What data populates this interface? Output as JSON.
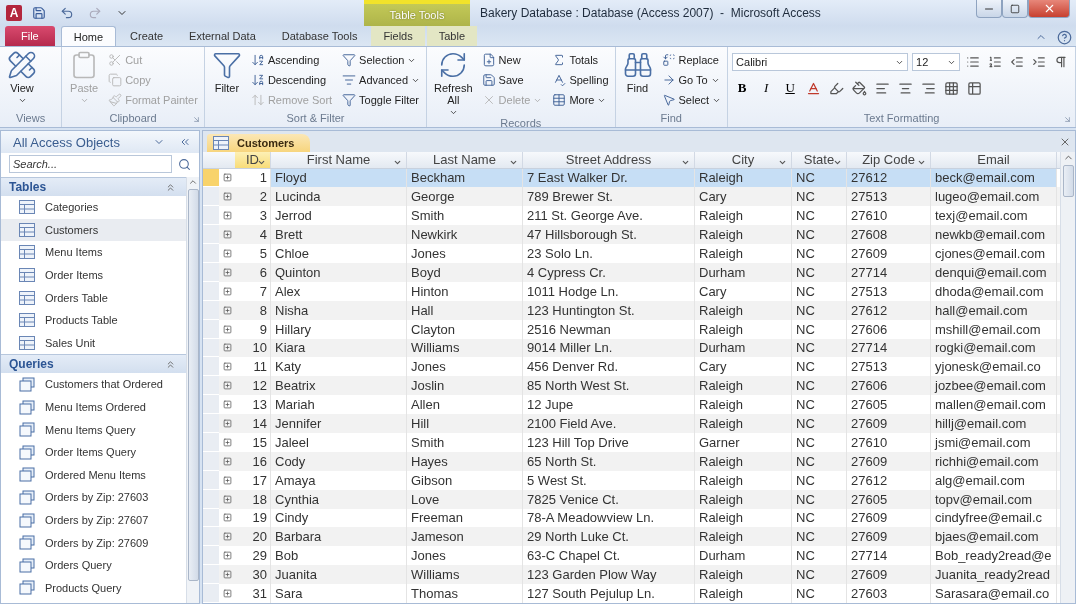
{
  "window": {
    "app_logo": "A",
    "title": "Bakery Database : Database (Access 2007)  -  Microsoft Access",
    "context_label": "Table Tools"
  },
  "tabs": [
    {
      "label": "File",
      "kind": "file",
      "selected": false
    },
    {
      "label": "Home",
      "kind": "normal",
      "selected": true
    },
    {
      "label": "Create",
      "kind": "normal",
      "selected": false
    },
    {
      "label": "External Data",
      "kind": "normal",
      "selected": false
    },
    {
      "label": "Database Tools",
      "kind": "normal",
      "selected": false
    },
    {
      "label": "Fields",
      "kind": "context",
      "selected": false
    },
    {
      "label": "Table",
      "kind": "context",
      "selected": false
    }
  ],
  "ribbon": {
    "groups": [
      {
        "label": "Views",
        "launcher": false,
        "items": [
          {
            "label": "View",
            "kind": "large",
            "menu": true,
            "disabled": false
          }
        ]
      },
      {
        "label": "Clipboard",
        "launcher": true,
        "items": [
          {
            "label": "Paste",
            "kind": "large",
            "menu": true,
            "disabled": true
          },
          {
            "label": "Cut",
            "kind": "small",
            "menu": false,
            "disabled": true
          },
          {
            "label": "Copy",
            "kind": "small",
            "menu": false,
            "disabled": true
          },
          {
            "label": "Format Painter",
            "kind": "small",
            "menu": false,
            "disabled": true
          }
        ]
      },
      {
        "label": "Sort & Filter",
        "launcher": false,
        "items": [
          {
            "label": "Filter",
            "kind": "large",
            "menu": false,
            "disabled": false
          },
          {
            "label": "Ascending",
            "kind": "small",
            "menu": false,
            "disabled": false
          },
          {
            "label": "Descending",
            "kind": "small",
            "menu": false,
            "disabled": false
          },
          {
            "label": "Remove Sort",
            "kind": "small",
            "menu": false,
            "disabled": true
          },
          {
            "label": "Selection",
            "kind": "small",
            "menu": true,
            "disabled": false
          },
          {
            "label": "Advanced",
            "kind": "small",
            "menu": true,
            "disabled": false
          },
          {
            "label": "Toggle Filter",
            "kind": "small",
            "menu": false,
            "disabled": false
          }
        ]
      },
      {
        "label": "Records",
        "launcher": false,
        "items": [
          {
            "label": "Refresh All",
            "kind": "large",
            "menu": true,
            "disabled": false
          },
          {
            "label": "New",
            "kind": "small",
            "menu": false,
            "disabled": false
          },
          {
            "label": "Save",
            "kind": "small",
            "menu": false,
            "disabled": false
          },
          {
            "label": "Delete",
            "kind": "small",
            "menu": true,
            "disabled": true
          },
          {
            "label": "Totals",
            "kind": "small",
            "menu": false,
            "disabled": false
          },
          {
            "label": "Spelling",
            "kind": "small",
            "menu": false,
            "disabled": false
          },
          {
            "label": "More",
            "kind": "small",
            "menu": true,
            "disabled": false
          }
        ]
      },
      {
        "label": "Find",
        "launcher": false,
        "items": [
          {
            "label": "Find",
            "kind": "large",
            "menu": false,
            "disabled": false
          },
          {
            "label": "Replace",
            "kind": "small",
            "menu": false,
            "disabled": false
          },
          {
            "label": "Go To",
            "kind": "small",
            "menu": true,
            "disabled": false
          },
          {
            "label": "Select",
            "kind": "small",
            "menu": true,
            "disabled": false
          }
        ]
      }
    ],
    "text_formatting": {
      "label": "Text Formatting",
      "font": "Calibri",
      "size": "12",
      "style_buttons": [
        "B",
        "I",
        "U"
      ],
      "launcher": true
    }
  },
  "navigation": {
    "title": "All Access Objects",
    "search_placeholder": "Search...",
    "groups": [
      {
        "label": "Tables",
        "kind": "table",
        "items": [
          {
            "label": "Categories",
            "selected": false
          },
          {
            "label": "Customers",
            "selected": true
          },
          {
            "label": "Menu Items",
            "selected": false
          },
          {
            "label": "Order Items",
            "selected": false
          },
          {
            "label": "Orders Table",
            "selected": false
          },
          {
            "label": "Products Table",
            "selected": false
          },
          {
            "label": "Sales Unit",
            "selected": false
          }
        ]
      },
      {
        "label": "Queries",
        "kind": "query",
        "items": [
          {
            "label": "Customers that Ordered",
            "selected": false
          },
          {
            "label": "Menu Items Ordered",
            "selected": false
          },
          {
            "label": "Menu Items Query",
            "selected": false
          },
          {
            "label": "Order Items Query",
            "selected": false
          },
          {
            "label": "Ordered Menu Items",
            "selected": false
          },
          {
            "label": "Orders by Zip: 27603",
            "selected": false
          },
          {
            "label": "Orders by Zip: 27607",
            "selected": false
          },
          {
            "label": "Orders by Zip: 27609",
            "selected": false
          },
          {
            "label": "Orders Query",
            "selected": false
          },
          {
            "label": "Products Query",
            "selected": false
          }
        ]
      }
    ]
  },
  "datasheet": {
    "tab": "Customers",
    "columns": [
      {
        "label": "ID",
        "menu": true,
        "selected": true
      },
      {
        "label": "First Name",
        "menu": true,
        "selected": false
      },
      {
        "label": "Last Name",
        "menu": true,
        "selected": false
      },
      {
        "label": "Street Address",
        "menu": true,
        "selected": false
      },
      {
        "label": "City",
        "menu": true,
        "selected": false
      },
      {
        "label": "State",
        "menu": true,
        "selected": false
      },
      {
        "label": "Zip Code",
        "menu": true,
        "selected": false
      },
      {
        "label": "Email",
        "menu": false,
        "selected": false
      }
    ],
    "rows": [
      {
        "selected": true,
        "cells": [
          "1",
          "Floyd",
          "Beckham",
          "7 East Walker Dr.",
          "Raleigh",
          "NC",
          "27612",
          "beck@email.com"
        ]
      },
      {
        "selected": false,
        "cells": [
          "2",
          "Lucinda",
          "George",
          "789 Brewer St.",
          "Cary",
          "NC",
          "27513",
          "lugeo@email.com"
        ]
      },
      {
        "selected": false,
        "cells": [
          "3",
          "Jerrod",
          "Smith",
          "211 St. George Ave.",
          "Raleigh",
          "NC",
          "27610",
          "texj@email.com"
        ]
      },
      {
        "selected": false,
        "cells": [
          "4",
          "Brett",
          "Newkirk",
          "47 Hillsborough St.",
          "Raleigh",
          "NC",
          "27608",
          "newkb@email.com"
        ]
      },
      {
        "selected": false,
        "cells": [
          "5",
          "Chloe",
          "Jones",
          "23 Solo Ln.",
          "Raleigh",
          "NC",
          "27609",
          "cjones@email.com"
        ]
      },
      {
        "selected": false,
        "cells": [
          "6",
          "Quinton",
          "Boyd",
          "4 Cypress Cr.",
          "Durham",
          "NC",
          "27714",
          "denqui@email.com"
        ]
      },
      {
        "selected": false,
        "cells": [
          "7",
          "Alex",
          "Hinton",
          "1011 Hodge Ln.",
          "Cary",
          "NC",
          "27513",
          "dhoda@email.com"
        ]
      },
      {
        "selected": false,
        "cells": [
          "8",
          "Nisha",
          "Hall",
          "123 Huntington St.",
          "Raleigh",
          "NC",
          "27612",
          "hall@email.com"
        ]
      },
      {
        "selected": false,
        "cells": [
          "9",
          "Hillary",
          "Clayton",
          "2516 Newman",
          "Raleigh",
          "NC",
          "27606",
          "mshill@email.com"
        ]
      },
      {
        "selected": false,
        "cells": [
          "10",
          "Kiara",
          "Williams",
          "9014 Miller Ln.",
          "Durham",
          "NC",
          "27714",
          "rogki@email.com"
        ]
      },
      {
        "selected": false,
        "cells": [
          "11",
          "Katy",
          "Jones",
          "456 Denver Rd.",
          "Cary",
          "NC",
          "27513",
          "yjonesk@email.co"
        ]
      },
      {
        "selected": false,
        "cells": [
          "12",
          "Beatrix",
          "Joslin",
          "85 North West St.",
          "Raleigh",
          "NC",
          "27606",
          "jozbee@email.com"
        ]
      },
      {
        "selected": false,
        "cells": [
          "13",
          "Mariah",
          "Allen",
          "12 Jupe",
          "Raleigh",
          "NC",
          "27605",
          "mallen@email.com"
        ]
      },
      {
        "selected": false,
        "cells": [
          "14",
          "Jennifer",
          "Hill",
          "2100 Field Ave.",
          "Raleigh",
          "NC",
          "27609",
          "hillj@email.com"
        ]
      },
      {
        "selected": false,
        "cells": [
          "15",
          "Jaleel",
          "Smith",
          "123 Hill Top Drive",
          "Garner",
          "NC",
          "27610",
          "jsmi@email.com"
        ]
      },
      {
        "selected": false,
        "cells": [
          "16",
          "Cody",
          "Hayes",
          "65 North St.",
          "Raleigh",
          "NC",
          "27609",
          "richhi@email.com"
        ]
      },
      {
        "selected": false,
        "cells": [
          "17",
          "Amaya",
          "Gibson",
          "5 West St.",
          "Raleigh",
          "NC",
          "27612",
          "alg@email.com"
        ]
      },
      {
        "selected": false,
        "cells": [
          "18",
          "Cynthia",
          "Love",
          "7825 Venice Ct.",
          "Raleigh",
          "NC",
          "27605",
          "topv@email.com"
        ]
      },
      {
        "selected": false,
        "cells": [
          "19",
          "Cindy",
          "Freeman",
          "78-A Meadowview Ln.",
          "Raleigh",
          "NC",
          "27609",
          "cindyfree@email.c"
        ]
      },
      {
        "selected": false,
        "cells": [
          "20",
          "Barbara",
          "Jameson",
          "29 North Luke Ct.",
          "Raleigh",
          "NC",
          "27609",
          "bjaes@email.com"
        ]
      },
      {
        "selected": false,
        "cells": [
          "29",
          "Bob",
          "Jones",
          "63-C Chapel Ct.",
          "Durham",
          "NC",
          "27714",
          "Bob_ready2read@e"
        ]
      },
      {
        "selected": false,
        "cells": [
          "30",
          "Juanita",
          "Williams",
          "123 Garden Plow Way",
          "Raleigh",
          "NC",
          "27609",
          "Juanita_ready2read"
        ]
      },
      {
        "selected": false,
        "cells": [
          "31",
          "Sara",
          "Thomas",
          "127 South Pejulup Ln.",
          "Raleigh",
          "NC",
          "27603",
          "Sarasara@email.co"
        ]
      }
    ]
  }
}
